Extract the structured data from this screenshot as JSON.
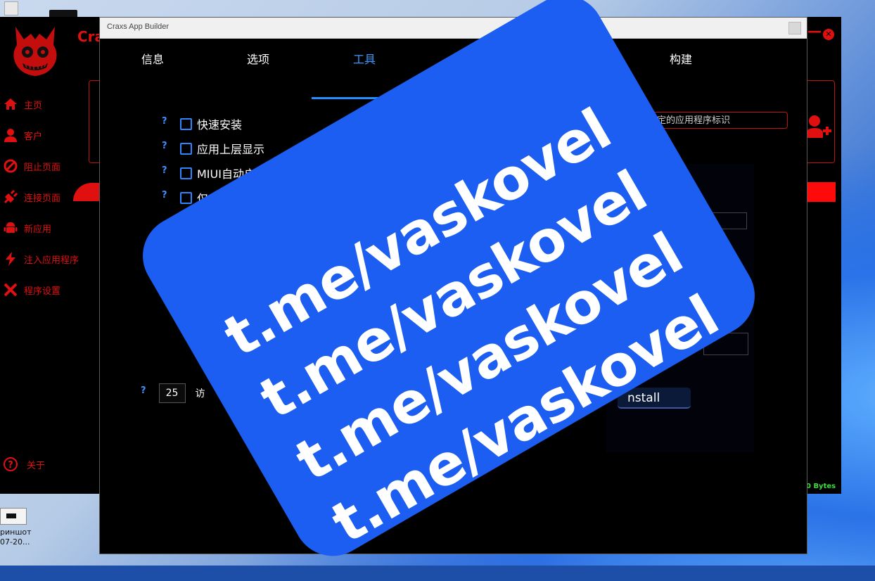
{
  "main_app": {
    "brand": "Cra",
    "nav": [
      {
        "label": "主页",
        "icon": "home-icon"
      },
      {
        "label": "客户",
        "icon": "user-icon"
      },
      {
        "label": "阻止页面",
        "icon": "block-icon"
      },
      {
        "label": "连接页面",
        "icon": "plug-icon"
      },
      {
        "label": "新应用",
        "icon": "android-icon"
      },
      {
        "label": "注入应用程序",
        "icon": "bolt-icon"
      },
      {
        "label": "程序设置",
        "icon": "tools-icon"
      }
    ],
    "about": "关于",
    "bytes": "0 Bytes",
    "accent": "#e01010"
  },
  "desktop": {
    "icon_label_line1": "риншот",
    "icon_label_line2": "07-20..."
  },
  "builder": {
    "title": "Craxs App Builder",
    "tabs": [
      "信息",
      "选项",
      "工具",
      "",
      "",
      "构建"
    ],
    "active_tab": "工具",
    "options": [
      {
        "help": "?",
        "label": "快速安装"
      },
      {
        "help": "?",
        "label": "应用上层显示"
      },
      {
        "help": "?",
        "label": "MIUI自动启动"
      },
      {
        "help": "?",
        "label": "仅在真"
      },
      {
        "help": "",
        "label": ""
      }
    ],
    "bind_placeholder": "绑定的应用程序标识",
    "install_label": "nstall",
    "bottom_help": "?",
    "bottom_value": "25",
    "bottom_label": "访",
    "accent": "#1e90ff"
  },
  "overlay": {
    "lines": [
      "t.me/vaskovel",
      "t.me/vaskovel",
      "t.me/vaskovel",
      "t.me/vaskovel"
    ],
    "color": "#1c5ef2"
  }
}
